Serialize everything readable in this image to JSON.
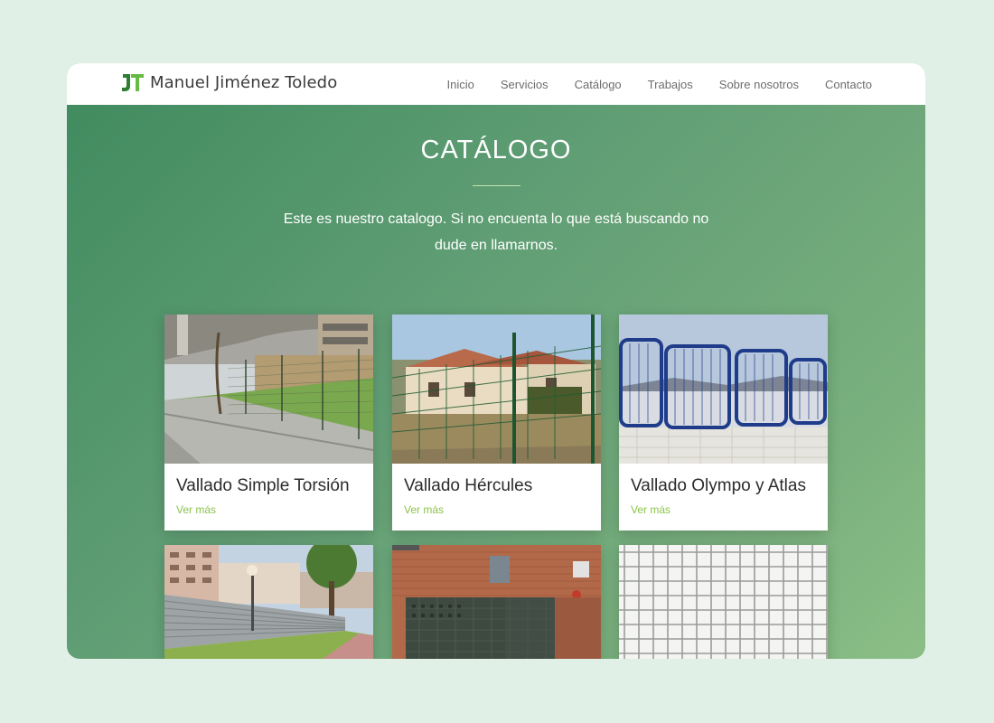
{
  "brand": {
    "initials": "JT",
    "name": "Manuel Jiménez Toledo"
  },
  "nav": [
    "Inicio",
    "Servicios",
    "Catálogo",
    "Trabajos",
    "Sobre nosotros",
    "Contacto"
  ],
  "hero": {
    "title": "CATÁLOGO",
    "description": "Este es nuestro catalogo. Si no encuenta lo que está buscando no dude en llamarnos."
  },
  "cards": [
    {
      "title": "Vallado Simple Torsión",
      "link": "Ver más",
      "image": "chain-link-fence-street-photo"
    },
    {
      "title": "Vallado Hércules",
      "link": "Ver más",
      "image": "green-panel-fence-house-photo"
    },
    {
      "title": "Vallado Olympo y Atlas",
      "link": "Ver más",
      "image": "blue-barrier-fence-wall-photo"
    },
    {
      "title": "",
      "link": "",
      "image": "metal-sheet-fence-street-photo"
    },
    {
      "title": "",
      "link": "",
      "image": "perforated-gate-brick-building-photo"
    },
    {
      "title": "",
      "link": "",
      "image": "wire-mesh-grid-photo"
    }
  ],
  "colors": {
    "accent": "#8bc34a",
    "brand_green": "#3e8a3e",
    "hero_start": "#3f8a5e",
    "hero_end": "#8cbf86"
  }
}
